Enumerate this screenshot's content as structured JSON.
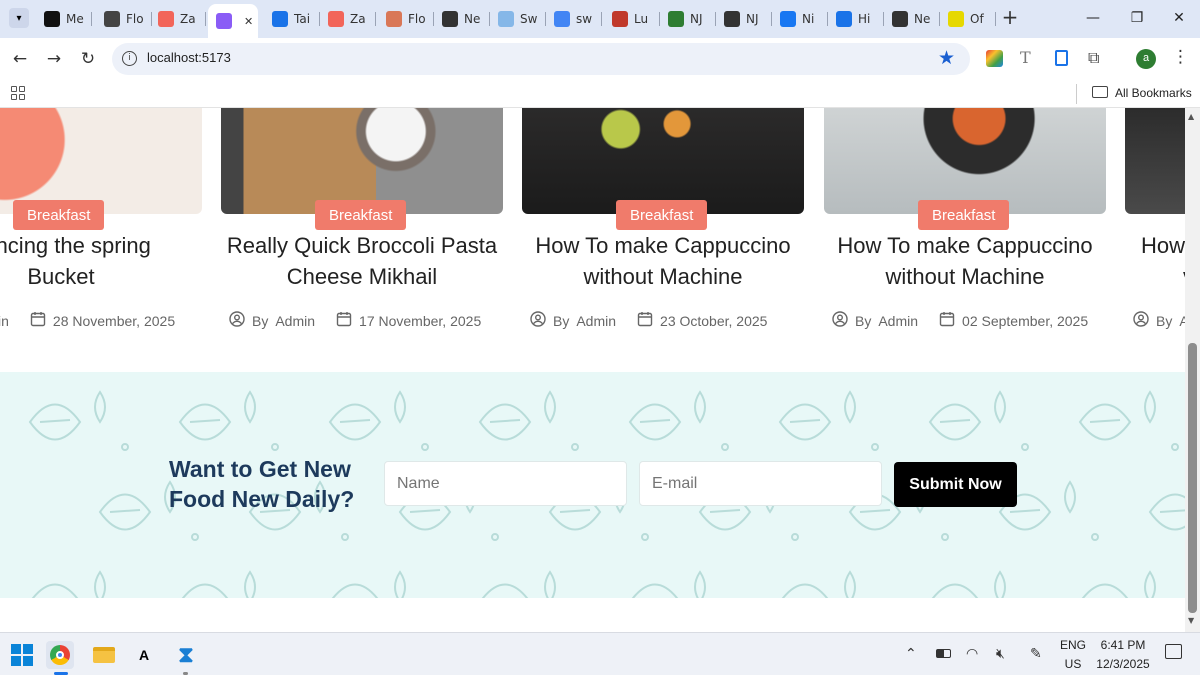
{
  "browser": {
    "tabs": [
      {
        "label": "Me",
        "icon": "notion-icon",
        "color": "#111111"
      },
      {
        "label": "Flo",
        "icon": "openai-icon",
        "color": "#444444"
      },
      {
        "label": "Za",
        "icon": "zapier-icon",
        "color": "#f2655a"
      },
      {
        "label": "",
        "icon": "vite-icon",
        "color": "#8a5cf6",
        "active": true
      },
      {
        "label": "Tai",
        "icon": "play-icon",
        "color": "#1a73e8"
      },
      {
        "label": "Za",
        "icon": "zapier-icon",
        "color": "#f2655a"
      },
      {
        "label": "Flo",
        "icon": "claude-icon",
        "color": "#d97757"
      },
      {
        "label": "Ne",
        "icon": "github-icon",
        "color": "#333333"
      },
      {
        "label": "Sw",
        "icon": "swagger-icon",
        "color": "#85b7e8"
      },
      {
        "label": "sw",
        "icon": "google-icon",
        "color": "#4285f4"
      },
      {
        "label": "Lu",
        "icon": "spiral-icon",
        "color": "#c0392b"
      },
      {
        "label": "NJ",
        "icon": "chart-icon",
        "color": "#2e7d32"
      },
      {
        "label": "NJ",
        "icon": "github-icon",
        "color": "#333333"
      },
      {
        "label": "Ni",
        "icon": "facebook-icon",
        "color": "#1877f2"
      },
      {
        "label": "Hi",
        "icon": "history-icon",
        "color": "#1a73e8"
      },
      {
        "label": "Ne",
        "icon": "github-icon",
        "color": "#333333"
      },
      {
        "label": "Of",
        "icon": "offer-icon",
        "color": "#e6d800"
      }
    ],
    "url": "localhost:5173",
    "bookmarks_label": "All Bookmarks",
    "profile_initial": "a"
  },
  "posts": [
    {
      "category": "Breakfast",
      "title_line1": "ouncing the spring",
      "title_line2": "Bucket",
      "author_prefix": "",
      "author": "in",
      "date": "28 November, 2025"
    },
    {
      "category": "Breakfast",
      "title_line1": "Really Quick Broccoli Pasta",
      "title_line2": "Cheese Mikhail",
      "author_prefix": "By",
      "author": "Admin",
      "date": "17 November, 2025"
    },
    {
      "category": "Breakfast",
      "title_line1": "How To make Cappuccino",
      "title_line2": "without Machine",
      "author_prefix": "By",
      "author": "Admin",
      "date": "23 October, 2025"
    },
    {
      "category": "Breakfast",
      "title_line1": "How To make Cappuccino",
      "title_line2": "without Machine",
      "author_prefix": "By",
      "author": "Admin",
      "date": "02 September, 2025"
    },
    {
      "category": "",
      "title_line1": "How",
      "title_line2": "v",
      "author_prefix": "By",
      "author": "A",
      "date": ""
    }
  ],
  "newsletter": {
    "title": "Want to Get New Food New Daily?",
    "name_placeholder": "Name",
    "email_placeholder": "E-mail",
    "submit_label": "Submit Now"
  },
  "taskbar": {
    "lang_line1": "ENG",
    "lang_line2": "US",
    "time": "6:41 PM",
    "date": "12/3/2025"
  },
  "colors": {
    "accent": "#f07b6b",
    "newsletter_bg": "#e8f8f7",
    "title_navy": "#1d3a5c"
  }
}
